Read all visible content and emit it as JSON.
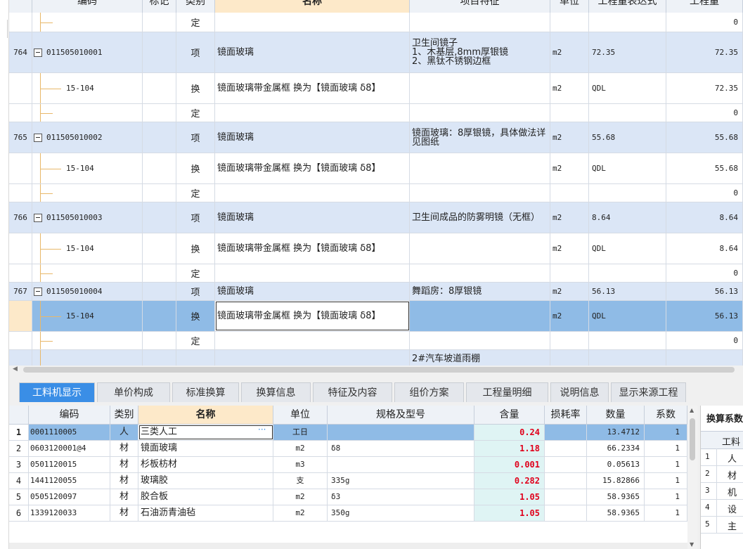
{
  "upper_grid": {
    "headers": {
      "code": "编码",
      "mark": "标记",
      "type": "类别",
      "name": "名称",
      "feature": "项目特征",
      "unit": "单位",
      "expr": "工程量表达式",
      "qty": "工程量"
    },
    "rows": [
      {
        "kind": "sub",
        "idx": "",
        "code": "",
        "type": "定",
        "name": "",
        "feature": "",
        "unit": "",
        "expr": "",
        "qty": "0"
      },
      {
        "kind": "item",
        "idx": "764",
        "code": "011505010001",
        "type": "项",
        "name": "镜面玻璃",
        "feature": "卫生间镜子\n1、木基层,8mm厚银镜\n2、黑钛不锈钢边框",
        "unit": "m2",
        "expr": "72.35",
        "qty": "72.35"
      },
      {
        "kind": "sub",
        "idx": "",
        "code": "15-104",
        "type": "换",
        "name": "镜面玻璃带金属框  换为【镜面玻璃 δ8】",
        "feature": "",
        "unit": "m2",
        "expr": "QDL",
        "qty": "72.35"
      },
      {
        "kind": "sub",
        "idx": "",
        "code": "",
        "type": "定",
        "name": "",
        "feature": "",
        "unit": "",
        "expr": "",
        "qty": "0"
      },
      {
        "kind": "item",
        "idx": "765",
        "code": "011505010002",
        "type": "项",
        "name": "镜面玻璃",
        "feature": "镜面玻璃：8厚银镜，具体做法详见图纸",
        "unit": "m2",
        "expr": "55.68",
        "qty": "55.68"
      },
      {
        "kind": "sub",
        "idx": "",
        "code": "15-104",
        "type": "换",
        "name": "镜面玻璃带金属框  换为【镜面玻璃 δ8】",
        "feature": "",
        "unit": "m2",
        "expr": "QDL",
        "qty": "55.68"
      },
      {
        "kind": "sub",
        "idx": "",
        "code": "",
        "type": "定",
        "name": "",
        "feature": "",
        "unit": "",
        "expr": "",
        "qty": "0"
      },
      {
        "kind": "item",
        "idx": "766",
        "code": "011505010003",
        "type": "项",
        "name": "镜面玻璃",
        "feature": "卫生间成品的防雾明镜（无框）",
        "unit": "m2",
        "expr": "8.64",
        "qty": "8.64"
      },
      {
        "kind": "sub",
        "idx": "",
        "code": "15-104",
        "type": "换",
        "name": "镜面玻璃带金属框  换为【镜面玻璃 δ8】",
        "feature": "",
        "unit": "m2",
        "expr": "QDL",
        "qty": "8.64"
      },
      {
        "kind": "sub",
        "idx": "",
        "code": "",
        "type": "定",
        "name": "",
        "feature": "",
        "unit": "",
        "expr": "",
        "qty": "0"
      },
      {
        "kind": "item",
        "idx": "767",
        "code": "011505010004",
        "type": "项",
        "name": "镜面玻璃",
        "feature": "舞蹈房：8厚银镜",
        "unit": "m2",
        "expr": "56.13",
        "qty": "56.13"
      },
      {
        "kind": "selected",
        "idx": "",
        "code": "15-104",
        "type": "换",
        "name": "镜面玻璃带金属框  换为【镜面玻璃 δ8】",
        "feature": "",
        "unit": "m2",
        "expr": "QDL",
        "qty": "56.13"
      },
      {
        "kind": "sub",
        "idx": "",
        "code": "",
        "type": "定",
        "name": "",
        "feature": "",
        "unit": "",
        "expr": "",
        "qty": "0"
      },
      {
        "kind": "item",
        "idx": "",
        "code": "",
        "type": "",
        "name": "",
        "feature": "2#汽车坡道雨棚",
        "unit": "",
        "expr": "",
        "qty": ""
      }
    ]
  },
  "tabs": [
    "工料机显示",
    "单价构成",
    "标准换算",
    "换算信息",
    "特征及内容",
    "组价方案",
    "工程量明细",
    "说明信息",
    "显示来源工程"
  ],
  "active_tab": "工料机显示",
  "lower_grid": {
    "headers": {
      "code": "编码",
      "type": "类别",
      "name": "名称",
      "unit": "单位",
      "spec": "规格及型号",
      "amount": "含量",
      "loss": "损耗率",
      "qty": "数量",
      "coef": "系数"
    },
    "rows": [
      {
        "no": "1",
        "code": "0001110005",
        "type": "人",
        "name": "三类人工",
        "unit": "工日",
        "spec": "",
        "amount": "0.24",
        "loss": "",
        "qty": "13.4712",
        "coef": "1"
      },
      {
        "no": "2",
        "code": "0603120001@4",
        "type": "材",
        "name": "镜面玻璃",
        "unit": "m2",
        "spec": "δ8",
        "amount": "1.18",
        "loss": "",
        "qty": "66.2334",
        "coef": "1"
      },
      {
        "no": "3",
        "code": "0501120015",
        "type": "材",
        "name": "杉板枋材",
        "unit": "m3",
        "spec": "",
        "amount": "0.001",
        "loss": "",
        "qty": "0.05613",
        "coef": "1"
      },
      {
        "no": "4",
        "code": "1441120055",
        "type": "材",
        "name": "玻璃胶",
        "unit": "支",
        "spec": "335g",
        "amount": "0.282",
        "loss": "",
        "qty": "15.82866",
        "coef": "1"
      },
      {
        "no": "5",
        "code": "0505120097",
        "type": "材",
        "name": "胶合板",
        "unit": "m2",
        "spec": "δ3",
        "amount": "1.05",
        "loss": "",
        "qty": "58.9365",
        "coef": "1"
      },
      {
        "no": "6",
        "code": "1339120033",
        "type": "材",
        "name": "石油沥青油毡",
        "unit": "m2",
        "spec": "350g",
        "amount": "1.05",
        "loss": "",
        "qty": "58.9365",
        "coef": "1"
      }
    ]
  },
  "right_panel": {
    "title": "换算系数",
    "header": "工料",
    "rows": [
      {
        "no": "1",
        "text": "人"
      },
      {
        "no": "2",
        "text": "材"
      },
      {
        "no": "3",
        "text": "机"
      },
      {
        "no": "4",
        "text": "设"
      },
      {
        "no": "5",
        "text": "主"
      }
    ]
  },
  "colors": {
    "active_tab": "#3a8ee6",
    "selected_row": "#8fbbe6",
    "item_row": "#dbe6f6",
    "amount_text": "#e0001b",
    "name_header": "#fde9c9"
  },
  "icons": {
    "collapse": "minus-box-icon",
    "ellipsis": "ellipsis-icon",
    "scroll_left": "arrow-left-icon",
    "scroll_up": "arrow-up-icon",
    "scroll_down": "arrow-down-icon"
  }
}
